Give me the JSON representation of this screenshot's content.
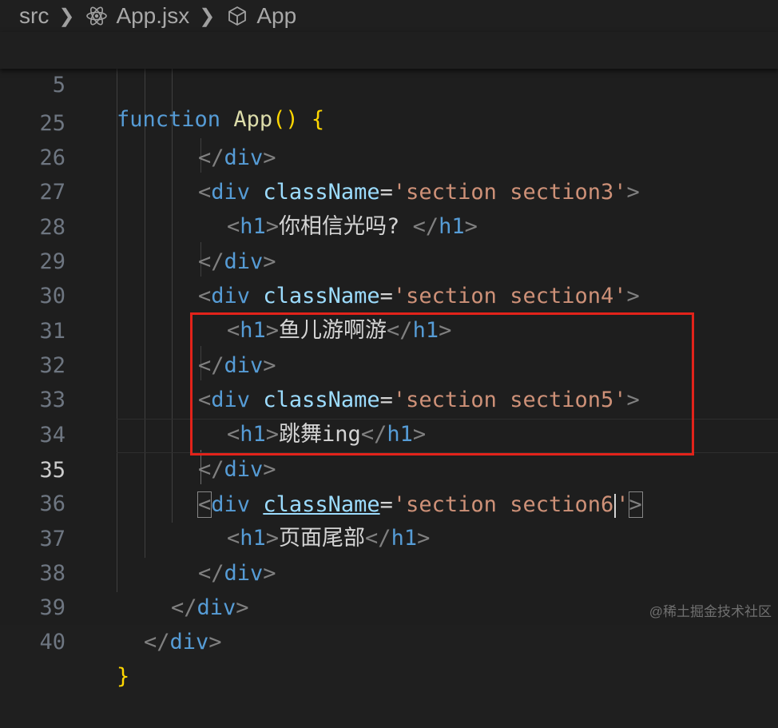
{
  "breadcrumb": {
    "folder": "src",
    "file": "App.jsx",
    "symbol": "App",
    "file_icon": "react-icon",
    "symbol_icon": "cube-icon"
  },
  "sticky": {
    "line_number": "5",
    "keyword": "function",
    "name": "App",
    "parens": "()",
    "brace": "{"
  },
  "lines": {
    "l25": {
      "num": "25",
      "close": "</",
      "tag": "div",
      "end": ">"
    },
    "l26": {
      "num": "26",
      "open": "<",
      "tag": "div",
      "attr": "className",
      "eq": "=",
      "value": "'section section3'",
      "end": ">"
    },
    "l27": {
      "num": "27",
      "open": "<",
      "tag": "h1",
      "close_open": ">",
      "text": "你相信光吗? ",
      "close": "</",
      "close_tag": "h1",
      "end": ">"
    },
    "l28": {
      "num": "28",
      "close": "</",
      "tag": "div",
      "end": ">"
    },
    "l29": {
      "num": "29",
      "open": "<",
      "tag": "div",
      "attr": "className",
      "eq": "=",
      "value": "'section section4'",
      "end": ">"
    },
    "l30": {
      "num": "30",
      "open": "<",
      "tag": "h1",
      "close_open": ">",
      "text": "鱼儿游啊游",
      "close": "</",
      "close_tag": "h1",
      "end": ">"
    },
    "l31": {
      "num": "31",
      "close": "</",
      "tag": "div",
      "end": ">"
    },
    "l32": {
      "num": "32",
      "open": "<",
      "tag": "div",
      "attr": "className",
      "eq": "=",
      "value": "'section section5'",
      "end": ">"
    },
    "l33": {
      "num": "33",
      "open": "<",
      "tag": "h1",
      "close_open": ">",
      "text": "跳舞ing",
      "close": "</",
      "close_tag": "h1",
      "end": ">"
    },
    "l34": {
      "num": "34",
      "close": "</",
      "tag": "div",
      "end": ">"
    },
    "l35": {
      "num": "35",
      "open": "<",
      "tag": "div",
      "attr": "className",
      "eq": "=",
      "value_a": "'section section6",
      "value_b": "'",
      "end": ">"
    },
    "l36": {
      "num": "36",
      "open": "<",
      "tag": "h1",
      "close_open": ">",
      "text": "页面尾部",
      "close": "</",
      "close_tag": "h1",
      "end": ">"
    },
    "l37": {
      "num": "37",
      "close": "</",
      "tag": "div",
      "end": ">"
    },
    "l38": {
      "num": "38",
      "close": "</",
      "tag": "div",
      "end": ">"
    },
    "l39": {
      "num": "39",
      "close": "</",
      "tag": "div",
      "end": ">"
    },
    "l40": {
      "num": "40",
      "brace": "}"
    }
  },
  "active_line": "35",
  "colors": {
    "highlight_box": "#e2231a",
    "keyword": "#569cd6",
    "string": "#ce9178",
    "attribute": "#9cdcfe"
  },
  "watermark": "@稀土掘金技术社区"
}
